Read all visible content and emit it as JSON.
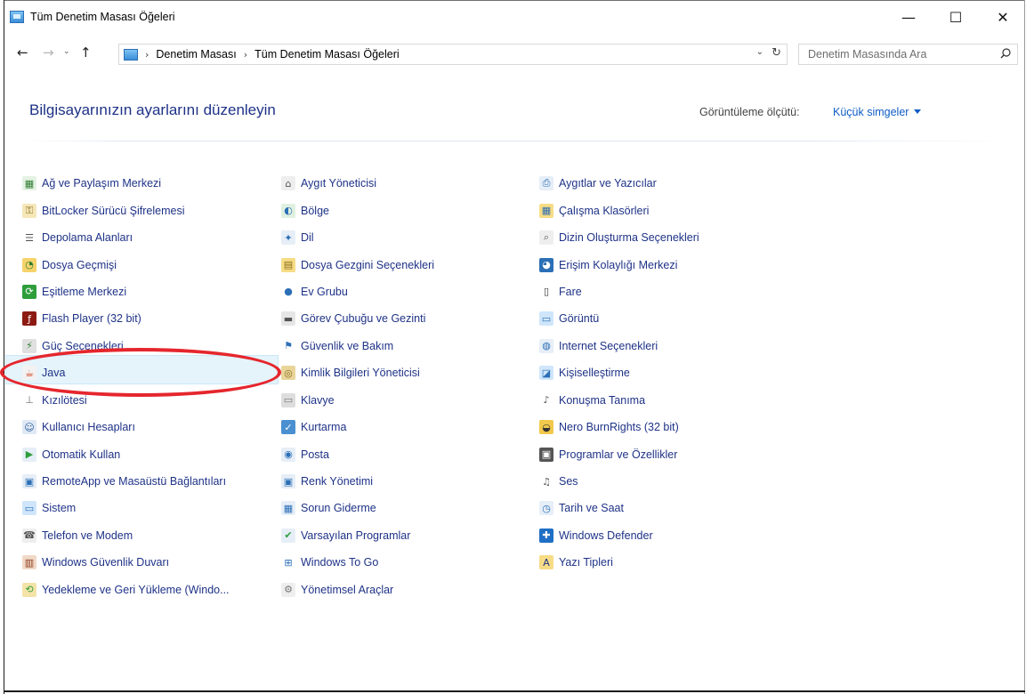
{
  "window": {
    "title": "Tüm Denetim Masası Öğeleri",
    "minimize_glyph": "—",
    "maximize_glyph": "☐",
    "close_glyph": "✕"
  },
  "nav": {
    "back_glyph": "←",
    "forward_glyph": "→",
    "recent_glyph": "⌄",
    "up_glyph": "↑",
    "crumbs": [
      "Denetim Masası",
      "Tüm Denetim Masası Öğeleri"
    ],
    "separator": "›",
    "dropdown_glyph": "⌄",
    "refresh_glyph": "↻",
    "search_placeholder": "Denetim Masasında Ara"
  },
  "header": {
    "title": "Bilgisayarınızın ayarlarını düzenleyin",
    "view_label": "Görüntüleme ölçütü:",
    "view_value": "Küçük simgeler"
  },
  "colors": {
    "link": "#1e3287",
    "accent": "#0f5cc4",
    "highlight_ring": "#e5262d",
    "hover_row": "#e5f3fb"
  },
  "columns": [
    [
      {
        "label": "Ağ ve Paylaşım Merkezi",
        "icon": "network-icon",
        "glyph": "▦",
        "color": "#2f7d32",
        "bg": "#e4f2e4"
      },
      {
        "label": "BitLocker Sürücü Şifrelemesi",
        "icon": "bitlocker-icon",
        "glyph": "⚿",
        "color": "#8a6d1e",
        "bg": "#f5e7b8"
      },
      {
        "label": "Depolama Alanları",
        "icon": "storage-icon",
        "glyph": "☰",
        "color": "#555555",
        "bg": "#ffffff"
      },
      {
        "label": "Dosya Geçmişi",
        "icon": "file-history-icon",
        "glyph": "◔",
        "color": "#2e7d32",
        "bg": "#f6d36b"
      },
      {
        "label": "Eşitleme Merkezi",
        "icon": "sync-center-icon",
        "glyph": "⟳",
        "color": "#ffffff",
        "bg": "#2e9e3b"
      },
      {
        "label": "Flash Player (32 bit)",
        "icon": "flash-icon",
        "glyph": "ƒ",
        "color": "#ffffff",
        "bg": "#8c1a12"
      },
      {
        "label": "Güç Seçenekleri",
        "icon": "power-options-icon",
        "glyph": "⚡",
        "color": "#2e7d32",
        "bg": "#e0e0e0"
      },
      {
        "label": "Java",
        "icon": "java-icon",
        "glyph": "☕",
        "color": "#d0391b",
        "bg": "#f2f2f2"
      },
      {
        "label": "Kızılötesi",
        "icon": "infrared-icon",
        "glyph": "⊥",
        "color": "#6b6b6b",
        "bg": "#ffffff"
      },
      {
        "label": "Kullanıcı Hesapları",
        "icon": "user-accounts-icon",
        "glyph": "☺",
        "color": "#2b5c9c",
        "bg": "#dfe9f5"
      },
      {
        "label": "Otomatik Kullan",
        "icon": "autoplay-icon",
        "glyph": "▶",
        "color": "#2e9e3b",
        "bg": "#e6eef7"
      },
      {
        "label": "RemoteApp ve Masaüstü Bağlantıları",
        "icon": "remoteapp-icon",
        "glyph": "▣",
        "color": "#2b6fb6",
        "bg": "#e6eef7"
      },
      {
        "label": "Sistem",
        "icon": "system-icon",
        "glyph": "▭",
        "color": "#2b6fb6",
        "bg": "#cfe6fa"
      },
      {
        "label": "Telefon ve Modem",
        "icon": "phone-modem-icon",
        "glyph": "☎",
        "color": "#555555",
        "bg": "#eeeeee"
      },
      {
        "label": "Windows Güvenlik Duvarı",
        "icon": "firewall-icon",
        "glyph": "▥",
        "color": "#8b3a1a",
        "bg": "#f1d9c8"
      },
      {
        "label": "Yedekleme ve Geri Yükleme (Windo...",
        "icon": "backup-restore-icon",
        "glyph": "⟲",
        "color": "#2e9e3b",
        "bg": "#f4e3a8"
      }
    ],
    [
      {
        "label": "Aygıt Yöneticisi",
        "icon": "device-manager-icon",
        "glyph": "⌂",
        "color": "#555555",
        "bg": "#eeeeee"
      },
      {
        "label": "Bölge",
        "icon": "region-icon",
        "glyph": "◐",
        "color": "#2b6fb6",
        "bg": "#dff0e0"
      },
      {
        "label": "Dil",
        "icon": "language-icon",
        "glyph": "✦",
        "color": "#2b6fb6",
        "bg": "#e6eef7"
      },
      {
        "label": "Dosya Gezgini Seçenekleri",
        "icon": "folder-options-icon",
        "glyph": "▤",
        "color": "#8a6d1e",
        "bg": "#f7dc86"
      },
      {
        "label": "Ev Grubu",
        "icon": "homegroup-icon",
        "glyph": "●",
        "color": "#2b6fb6",
        "bg": "#ffffff"
      },
      {
        "label": "Görev Çubuğu ve Gezinti",
        "icon": "taskbar-icon",
        "glyph": "▬",
        "color": "#555555",
        "bg": "#e6e6e6"
      },
      {
        "label": "Güvenlik ve Bakım",
        "icon": "security-maintenance-icon",
        "glyph": "⚑",
        "color": "#2b6fb6",
        "bg": "#ffffff"
      },
      {
        "label": "Kimlik Bilgileri Yöneticisi",
        "icon": "credential-manager-icon",
        "glyph": "◎",
        "color": "#8a6d1e",
        "bg": "#e9d59a"
      },
      {
        "label": "Klavye",
        "icon": "keyboard-icon",
        "glyph": "▭",
        "color": "#777777",
        "bg": "#dddddd"
      },
      {
        "label": "Kurtarma",
        "icon": "recovery-icon",
        "glyph": "✓",
        "color": "#ffffff",
        "bg": "#4a8fd0"
      },
      {
        "label": "Posta",
        "icon": "mail-icon",
        "glyph": "◉",
        "color": "#2b6fb6",
        "bg": "#e6eef7"
      },
      {
        "label": "Renk Yönetimi",
        "icon": "color-management-icon",
        "glyph": "▣",
        "color": "#2b6fb6",
        "bg": "#e6eef7"
      },
      {
        "label": "Sorun Giderme",
        "icon": "troubleshooting-icon",
        "glyph": "▦",
        "color": "#2b6fb6",
        "bg": "#e6eef7"
      },
      {
        "label": "Varsayılan Programlar",
        "icon": "default-programs-icon",
        "glyph": "✔",
        "color": "#2e9e3b",
        "bg": "#e6eef7"
      },
      {
        "label": "Windows To Go",
        "icon": "windows-to-go-icon",
        "glyph": "⊞",
        "color": "#2b6fb6",
        "bg": "#ffffff"
      },
      {
        "label": "Yönetimsel Araçlar",
        "icon": "admin-tools-icon",
        "glyph": "⚙",
        "color": "#777777",
        "bg": "#eeeeee"
      }
    ],
    [
      {
        "label": "Aygıtlar ve Yazıcılar",
        "icon": "devices-printers-icon",
        "glyph": "⎙",
        "color": "#2b6fb6",
        "bg": "#e6eef7"
      },
      {
        "label": "Çalışma Klasörleri",
        "icon": "work-folders-icon",
        "glyph": "▦",
        "color": "#2b6fb6",
        "bg": "#f7dc86"
      },
      {
        "label": "Dizin Oluşturma Seçenekleri",
        "icon": "indexing-options-icon",
        "glyph": "⌕",
        "color": "#555555",
        "bg": "#eeeeee"
      },
      {
        "label": "Erişim Kolaylığı Merkezi",
        "icon": "ease-of-access-icon",
        "glyph": "◕",
        "color": "#ffffff",
        "bg": "#2b6fb6"
      },
      {
        "label": "Fare",
        "icon": "mouse-icon",
        "glyph": "▯",
        "color": "#333333",
        "bg": "#ffffff"
      },
      {
        "label": "Görüntü",
        "icon": "display-icon",
        "glyph": "▭",
        "color": "#2b6fb6",
        "bg": "#cfe6fa"
      },
      {
        "label": "Internet Seçenekleri",
        "icon": "internet-options-icon",
        "glyph": "◍",
        "color": "#2b6fb6",
        "bg": "#e6eef7"
      },
      {
        "label": "Kişiselleştirme",
        "icon": "personalization-icon",
        "glyph": "◪",
        "color": "#2b6fb6",
        "bg": "#cfe6fa"
      },
      {
        "label": "Konuşma Tanıma",
        "icon": "speech-recognition-icon",
        "glyph": "♪",
        "color": "#555555",
        "bg": "#ffffff"
      },
      {
        "label": "Nero BurnRights (32 bit)",
        "icon": "nero-icon",
        "glyph": "◒",
        "color": "#333333",
        "bg": "#f2c94c"
      },
      {
        "label": "Programlar ve Özellikler",
        "icon": "programs-features-icon",
        "glyph": "▣",
        "color": "#ffffff",
        "bg": "#555555"
      },
      {
        "label": "Ses",
        "icon": "sound-icon",
        "glyph": "♫",
        "color": "#555555",
        "bg": "#ffffff"
      },
      {
        "label": "Tarih ve Saat",
        "icon": "date-time-icon",
        "glyph": "◷",
        "color": "#2b6fb6",
        "bg": "#e6eef7"
      },
      {
        "label": "Windows Defender",
        "icon": "windows-defender-icon",
        "glyph": "✚",
        "color": "#ffffff",
        "bg": "#1f6fc5"
      },
      {
        "label": "Yazı Tipleri",
        "icon": "fonts-icon",
        "glyph": "A",
        "color": "#1e3287",
        "bg": "#f7dc86"
      }
    ]
  ],
  "highlighted_item": "Java"
}
